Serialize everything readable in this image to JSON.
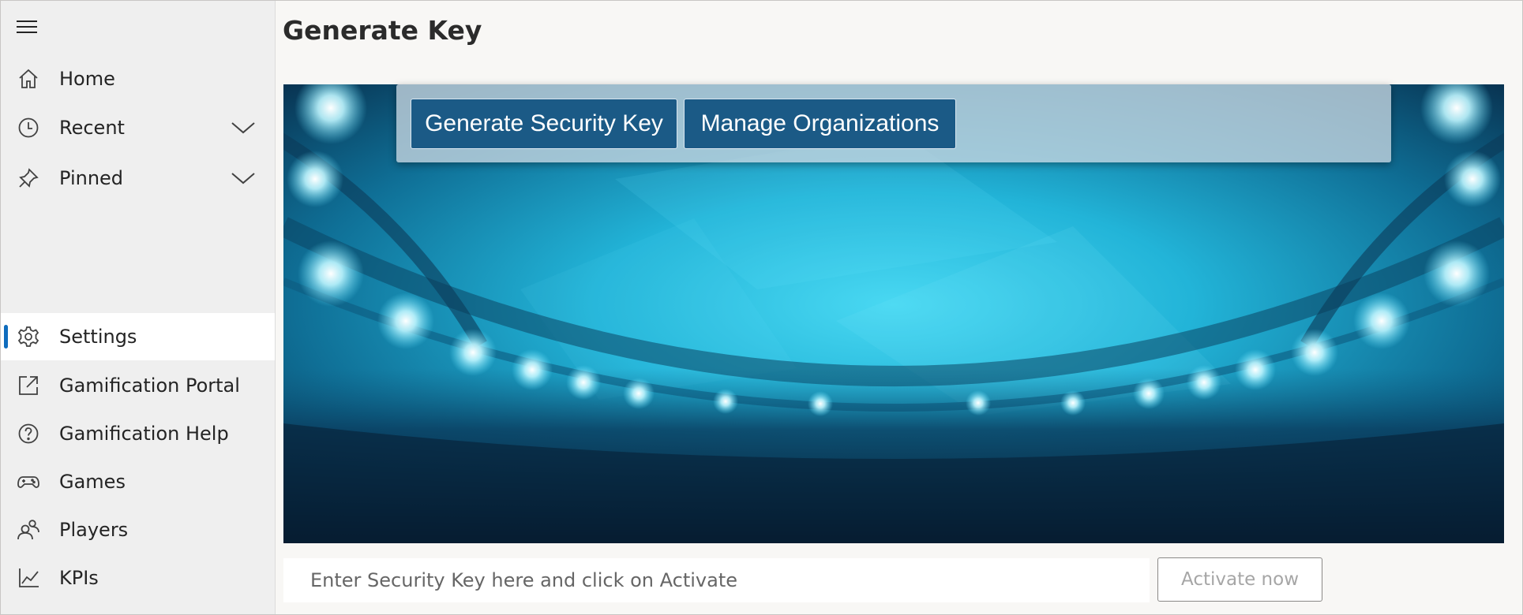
{
  "sidebar": {
    "menu_icon": "hamburger-menu-icon",
    "items": [
      {
        "label": "Home",
        "icon": "home-icon"
      },
      {
        "label": "Recent",
        "icon": "clock-icon",
        "expandable": true
      },
      {
        "label": "Pinned",
        "icon": "pin-icon",
        "expandable": true
      },
      {
        "label": "Settings",
        "icon": "gear-icon",
        "selected": true
      },
      {
        "label": "Gamification Portal",
        "icon": "external-link-icon"
      },
      {
        "label": "Gamification Help",
        "icon": "help-circle-icon"
      },
      {
        "label": "Games",
        "icon": "gamepad-icon"
      },
      {
        "label": "Players",
        "icon": "people-icon"
      },
      {
        "label": "KPIs",
        "icon": "line-chart-icon"
      }
    ]
  },
  "main": {
    "title": "Generate Key",
    "toolbar": {
      "generate_label": "Generate Security Key",
      "manage_label": "Manage Organizations"
    },
    "security_key": {
      "placeholder": "Enter Security Key here and click on Activate",
      "value": ""
    },
    "activate_label": "Activate now"
  },
  "colors": {
    "accent": "#0f6cbd",
    "toolbar_button": "#1b5a86",
    "banner_primary": "#27c3e3",
    "banner_dark": "#0a1e33"
  }
}
